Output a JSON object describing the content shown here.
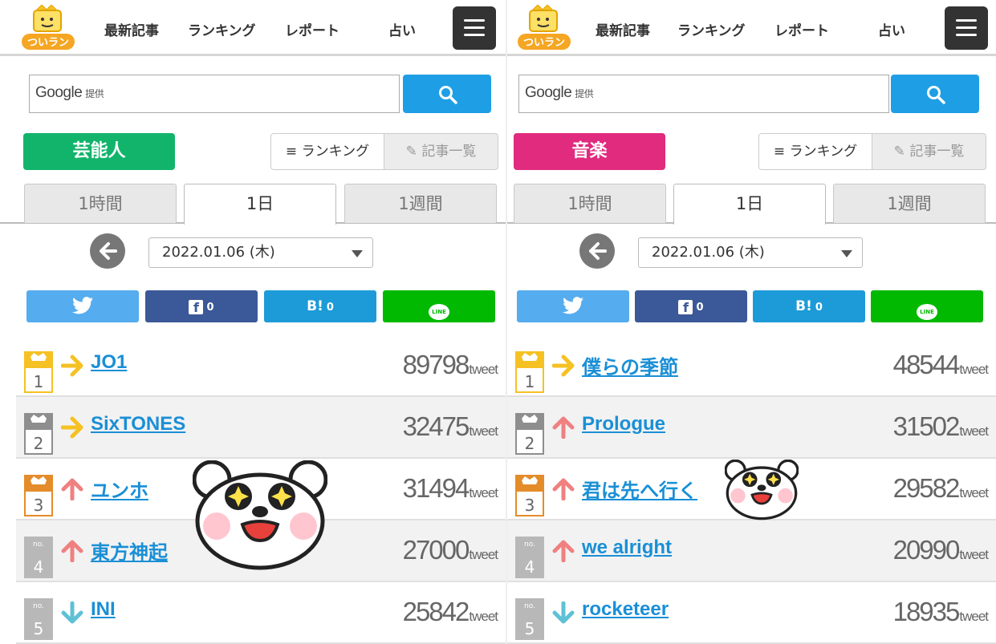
{
  "colors": {
    "accent": "#1e9ee5",
    "twitter": "#55acee",
    "facebook": "#3b5998",
    "hatena": "#1d9bd8",
    "line": "#00b900",
    "category_left": "#12b46b",
    "category_right": "#e02b7e",
    "gold": "#f5c123",
    "silver": "#8e8e8e",
    "bronze": "#e58c2a",
    "up": "#f08080",
    "same": "#f5c123",
    "down": "#5fc0d6"
  },
  "panels": [
    {
      "logo": "ついラン",
      "nav": [
        "最新記事",
        "ランキング",
        "レポート",
        "占い"
      ],
      "search_placeholder": "Google",
      "search_placeholder_small": "提供",
      "category": "芸能人",
      "ranking_button": "ランキング",
      "list_button": "記事一覧",
      "tabs": [
        "1時間",
        "1日",
        "1週間"
      ],
      "active_tab": "1日",
      "date": "2022.01.06 (木)",
      "share": {
        "facebook_count": "0",
        "hatena_label": "B!",
        "hatena_count": "0",
        "line_label": "LINE"
      },
      "tweet_unit": "tweet",
      "rankings": [
        {
          "rank": "1",
          "trend": "same",
          "title": "JO1",
          "count": "89798"
        },
        {
          "rank": "2",
          "trend": "same",
          "title": "SixTONES",
          "count": "32475"
        },
        {
          "rank": "3",
          "trend": "up",
          "title": "ユンホ",
          "count": "31494"
        },
        {
          "rank": "4",
          "trend": "up",
          "title": "東方神起",
          "count": "27000"
        },
        {
          "rank": "5",
          "trend": "down",
          "title": "INI",
          "count": "25842"
        }
      ]
    },
    {
      "logo": "ついラン",
      "nav": [
        "最新記事",
        "ランキング",
        "レポート",
        "占い"
      ],
      "search_placeholder": "Google",
      "search_placeholder_small": "提供",
      "category": "音楽",
      "ranking_button": "ランキング",
      "list_button": "記事一覧",
      "tabs": [
        "1時間",
        "1日",
        "1週間"
      ],
      "active_tab": "1日",
      "date": "2022.01.06 (木)",
      "share": {
        "facebook_count": "0",
        "hatena_label": "B!",
        "hatena_count": "0",
        "line_label": "LINE"
      },
      "tweet_unit": "tweet",
      "rankings": [
        {
          "rank": "1",
          "trend": "same",
          "title": "僕らの季節",
          "count": "48544"
        },
        {
          "rank": "2",
          "trend": "up",
          "title": "Prologue",
          "count": "31502"
        },
        {
          "rank": "3",
          "trend": "up",
          "title": "君は先へ行く",
          "count": "29582"
        },
        {
          "rank": "4",
          "trend": "up",
          "title": "we alright",
          "count": "20990"
        },
        {
          "rank": "5",
          "trend": "down",
          "title": "rocketeer",
          "count": "18935"
        }
      ]
    }
  ],
  "rank_badge_labels": {
    "crown": "♛",
    "no": "no."
  },
  "icons": [
    "logo-mascot-icon",
    "menu-icon",
    "search-icon",
    "ranking-list-icon",
    "edit-icon",
    "back-arrow-icon",
    "dropdown-arrow-icon",
    "twitter-icon",
    "facebook-icon",
    "hatena-icon",
    "line-icon",
    "trend-same-icon",
    "trend-up-icon",
    "trend-down-icon",
    "crown-icon",
    "bear-sticker"
  ]
}
